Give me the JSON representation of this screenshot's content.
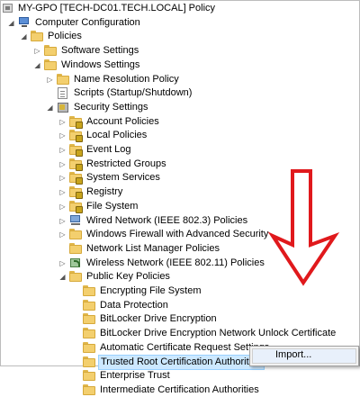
{
  "tree": [
    {
      "label": "MY-GPO [TECH-DC01.TECH.LOCAL] Policy",
      "icon": "gpo-icon",
      "expander": "",
      "level": 0
    },
    {
      "label": "Computer Configuration",
      "icon": "computer-icon",
      "expander": "◢",
      "level": 1
    },
    {
      "label": "Policies",
      "icon": "folder-icon",
      "expander": "◢",
      "level": 2
    },
    {
      "label": "Software Settings",
      "icon": "folder-icon",
      "expander": "▷",
      "level": 3
    },
    {
      "label": "Windows Settings",
      "icon": "folder-icon",
      "expander": "◢",
      "level": 3
    },
    {
      "label": "Name Resolution Policy",
      "icon": "folder-icon",
      "expander": "▷",
      "level": 4
    },
    {
      "label": "Scripts (Startup/Shutdown)",
      "icon": "document-icon",
      "expander": "",
      "level": 4
    },
    {
      "label": "Security Settings",
      "icon": "shield-icon",
      "expander": "◢",
      "level": 4
    },
    {
      "label": "Account Policies",
      "icon": "locked-folder-icon",
      "expander": "▷",
      "level": 5
    },
    {
      "label": "Local Policies",
      "icon": "locked-folder-icon",
      "expander": "▷",
      "level": 5
    },
    {
      "label": "Event Log",
      "icon": "locked-folder-icon",
      "expander": "▷",
      "level": 5
    },
    {
      "label": "Restricted Groups",
      "icon": "locked-folder-icon",
      "expander": "▷",
      "level": 5
    },
    {
      "label": "System Services",
      "icon": "locked-folder-icon",
      "expander": "▷",
      "level": 5
    },
    {
      "label": "Registry",
      "icon": "locked-folder-icon",
      "expander": "▷",
      "level": 5
    },
    {
      "label": "File System",
      "icon": "locked-folder-icon",
      "expander": "▷",
      "level": 5
    },
    {
      "label": "Wired Network (IEEE 802.3) Policies",
      "icon": "wired-network-icon",
      "expander": "▷",
      "level": 5
    },
    {
      "label": "Windows Firewall with Advanced Security",
      "icon": "folder-icon",
      "expander": "▷",
      "level": 5
    },
    {
      "label": "Network List Manager Policies",
      "icon": "folder-icon",
      "expander": "",
      "level": 5
    },
    {
      "label": "Wireless Network (IEEE 802.11) Policies",
      "icon": "wireless-network-icon",
      "expander": "▷",
      "level": 5
    },
    {
      "label": "Public Key Policies",
      "icon": "folder-icon",
      "expander": "◢",
      "level": 5
    },
    {
      "label": "Encrypting File System",
      "icon": "folder-icon",
      "expander": "",
      "level": 6
    },
    {
      "label": "Data Protection",
      "icon": "folder-icon",
      "expander": "",
      "level": 6
    },
    {
      "label": "BitLocker Drive Encryption",
      "icon": "folder-icon",
      "expander": "",
      "level": 6
    },
    {
      "label": "BitLocker Drive Encryption Network Unlock Certificate",
      "icon": "folder-icon",
      "expander": "",
      "level": 6
    },
    {
      "label": "Automatic Certificate Request Settings",
      "icon": "folder-icon",
      "expander": "",
      "level": 6
    },
    {
      "label": "Trusted Root Certification Authorities",
      "icon": "folder-icon",
      "expander": "",
      "level": 6,
      "selected": true
    },
    {
      "label": "Enterprise Trust",
      "icon": "folder-icon",
      "expander": "",
      "level": 6
    },
    {
      "label": "Intermediate Certification Authorities",
      "icon": "folder-icon",
      "expander": "",
      "level": 6
    }
  ],
  "context_menu": {
    "items": [
      {
        "label": "Import..."
      }
    ]
  },
  "annotation": {
    "color": "#e0191c",
    "icon": "red-down-arrow"
  }
}
